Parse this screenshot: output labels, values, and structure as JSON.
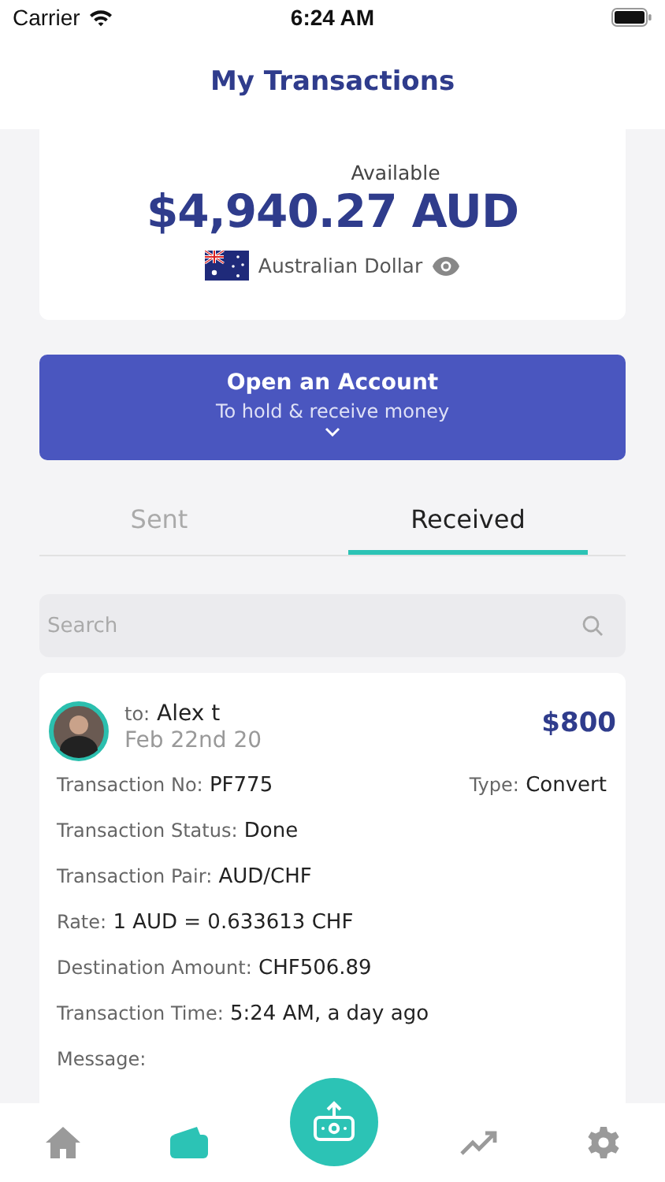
{
  "status_bar": {
    "carrier": "Carrier",
    "time": "6:24 AM"
  },
  "header": {
    "title": "My Transactions"
  },
  "balance": {
    "caption": "Available",
    "amount": "$4,940.27 AUD",
    "currency": "Australian Dollar"
  },
  "open_account": {
    "title": "Open an Account",
    "subtitle": "To hold & receive money"
  },
  "tabs": [
    {
      "label": "Sent",
      "selected": false
    },
    {
      "label": "Received",
      "selected": true
    }
  ],
  "search": {
    "placeholder": "Search"
  },
  "transaction": {
    "to_label": "to:",
    "name": "Alex t",
    "date": "Feb 22nd 20",
    "amount": "$800",
    "type": {
      "label": "Type:",
      "value": "Convert"
    },
    "details": [
      {
        "label": "Transaction No:",
        "value": "PF775"
      },
      {
        "label": "Transaction Status:",
        "value": "Done"
      },
      {
        "label": "Transaction Pair:",
        "value": "AUD/CHF"
      },
      {
        "label": "Rate:",
        "value": "1 AUD = 0.633613 CHF"
      },
      {
        "label": "Destination Amount:",
        "value": "CHF506.89"
      },
      {
        "label": "Transaction Time:",
        "value": "5:24 AM, a day ago"
      },
      {
        "label": "Message:"
      }
    ]
  },
  "tab_bar": [
    {
      "kind": "home",
      "selected": false
    },
    {
      "kind": "wallet",
      "selected": true
    },
    {
      "kind": "transfer",
      "selected": false
    },
    {
      "kind": "chart",
      "selected": false
    },
    {
      "kind": "settings",
      "selected": false
    }
  ]
}
